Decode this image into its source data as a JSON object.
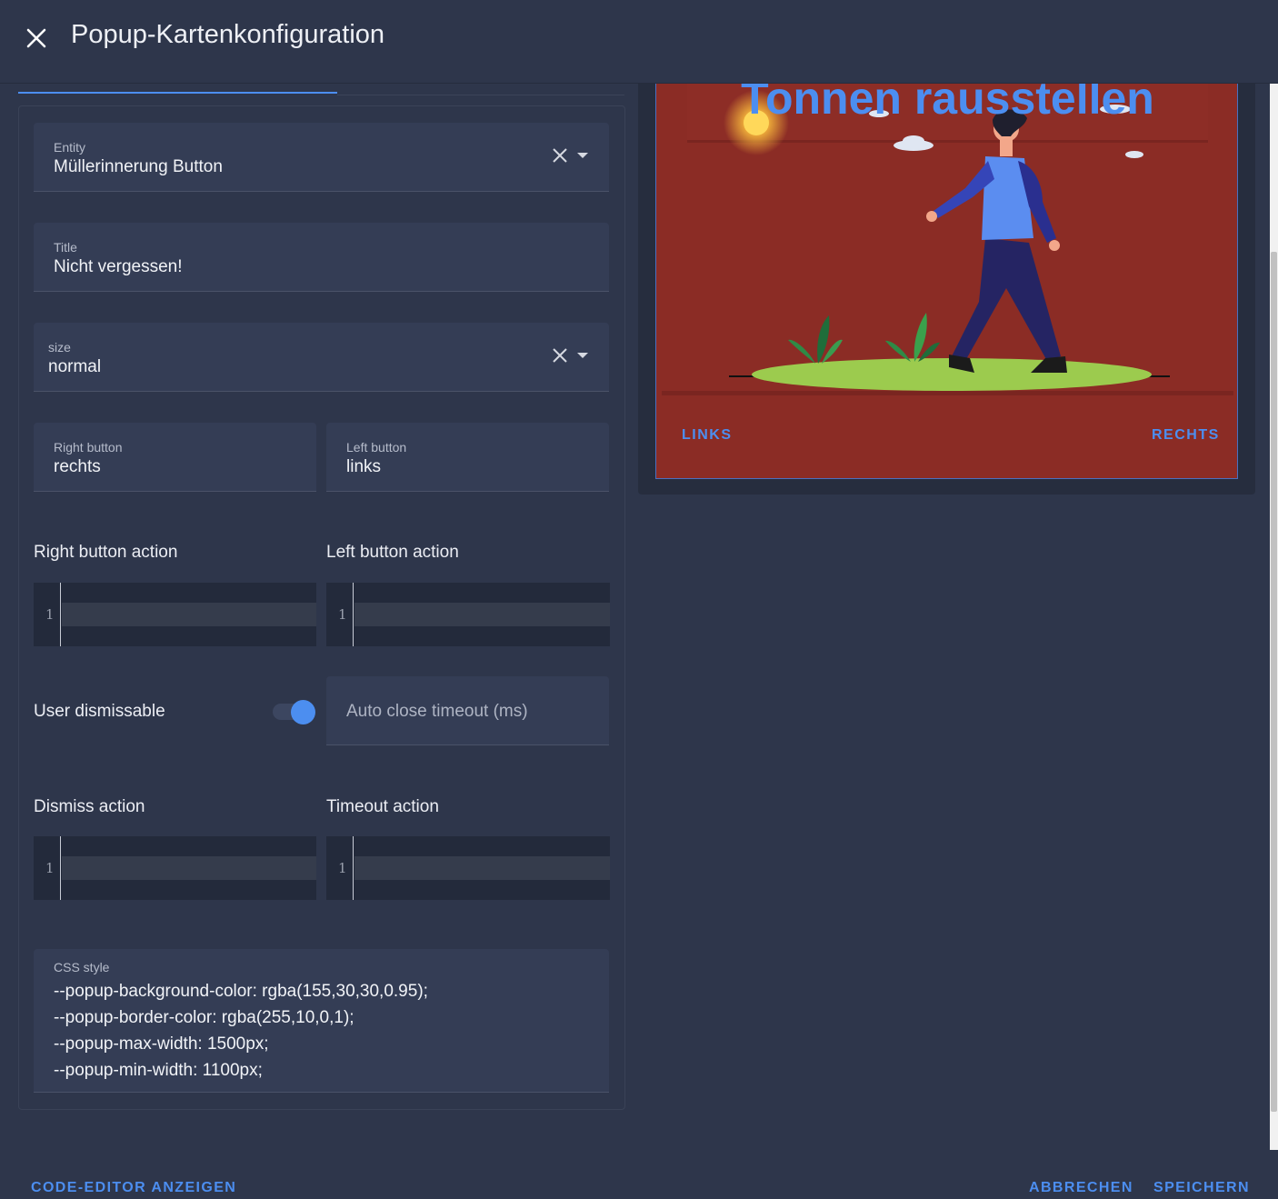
{
  "dialog": {
    "title": "Popup-Kartenkonfiguration"
  },
  "fields": {
    "entity": {
      "label": "Entity",
      "value": "Müllerinnerung Button"
    },
    "title": {
      "label": "Title",
      "value": "Nicht vergessen!"
    },
    "size": {
      "label": "size",
      "value": "normal"
    },
    "right_button": {
      "label": "Right button",
      "value": "rechts"
    },
    "left_button": {
      "label": "Left button",
      "value": "links"
    },
    "auto_close": {
      "placeholder": "Auto close timeout (ms)"
    },
    "css_style": {
      "label": "CSS style",
      "lines": [
        "--popup-background-color: rgba(155,30,30,0.95);",
        "--popup-border-color: rgba(255,10,0,1);",
        "--popup-max-width: 1500px;",
        "--popup-min-width: 1100px;"
      ]
    }
  },
  "sections": {
    "right_button_action": "Right button action",
    "left_button_action": "Left button action",
    "user_dismissable": "User dismissable",
    "dismiss_action": "Dismiss action",
    "timeout_action": "Timeout action"
  },
  "code_editors": {
    "line_number": "1"
  },
  "toggle": {
    "user_dismissable_on": true
  },
  "preview": {
    "heading": "Tonnen rausstellen",
    "left_button": "LINKS",
    "right_button": "RECHTS"
  },
  "footer": {
    "code_editor": "CODE-EDITOR ANZEIGEN",
    "cancel": "ABBRECHEN",
    "save": "SPEICHERN"
  },
  "colors": {
    "accent": "#4c8ef0",
    "background": "#2e364b",
    "field": "#343d55",
    "preview_background": "#8b2c25"
  }
}
